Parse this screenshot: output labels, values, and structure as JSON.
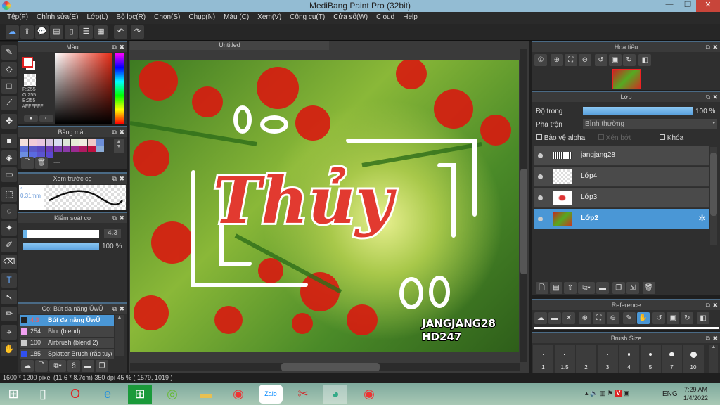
{
  "window": {
    "title": "MediBang Paint Pro (32bit)",
    "min": "—",
    "max": "❐",
    "close": "✕"
  },
  "menu": [
    "Tệp(F)",
    "Chỉnh sửa(E)",
    "Lớp(L)",
    "Bộ lọc(R)",
    "Chọn(S)",
    "Chụp(N)",
    "Màu (C)",
    "Xem(V)",
    "Công cụ(T)",
    "Cửa sổ(W)",
    "Cloud",
    "Help"
  ],
  "canvas": {
    "tab": "Untitled",
    "art_text": "Thủy",
    "watermark1": "JANGJANG28",
    "watermark2": "HD247"
  },
  "color_panel": {
    "title": "Màu",
    "r": "R:255",
    "g": "G:255",
    "b": "B:255",
    "hex": "#FFFFFF",
    "primary": "#ffffff",
    "accent": "#e02020"
  },
  "palette_panel": {
    "title": "Bảng màu",
    "colors": [
      "#f3e0dc",
      "#f2ccd8",
      "#e8c6e0",
      "#d6c6e0",
      "#d8dcf0",
      "#dce6d8",
      "#e6ecd6",
      "#f0ece0",
      "#f0c8c8",
      "#6c8ed8",
      "#5a6ed8",
      "#5a58c8",
      "#5a48c0",
      "#6a3cb8",
      "#7c3cb0",
      "#8a3aa8",
      "#9a2a90",
      "#b01a60",
      "#c01040",
      "#8cacd8",
      "#6c8ee0",
      "#5a6ae0",
      "#5a54d0",
      "#5a48d0"
    ],
    "dash": "---"
  },
  "brush_preview": {
    "title": "Xem trước cọ",
    "size": "0.31mm"
  },
  "brush_control": {
    "title": "Kiểm soát cọ",
    "size": "4.3",
    "opacity": "100 %",
    "size_fraction": 0.05,
    "opacity_fraction": 1.0
  },
  "brush_list": {
    "title": "Cọ: Bút đa năng ŬwŬ",
    "items": [
      {
        "size": "4.3",
        "name": "Bút đa năng ŬwŬ",
        "color": "#222222"
      },
      {
        "size": "254",
        "name": "Blur (blend)",
        "color": "#f0a0f0"
      },
      {
        "size": "100",
        "name": "Airbrush (blend 2)",
        "color": "#cccccc"
      },
      {
        "size": "185",
        "name": "Splatter Brush (rắc tuyết)",
        "color": "#3050f0"
      }
    ]
  },
  "navigator": {
    "title": "Hoa tiêu"
  },
  "layers": {
    "title": "Lớp",
    "opacity_label": "Độ trong",
    "opacity_value": "100 %",
    "opacity_fraction": 1.0,
    "blend_label": "Pha trộn",
    "blend_value": "Bình thường",
    "protect_alpha": "Bảo vệ alpha",
    "clip": "Xén bớt",
    "lock": "Khóa",
    "items": [
      {
        "name": "jangjang28"
      },
      {
        "name": "Lớp4"
      },
      {
        "name": "Lớp3"
      },
      {
        "name": "Lớp2"
      }
    ]
  },
  "reference": {
    "title": "Reference"
  },
  "brush_size": {
    "title": "Brush Size",
    "sizes": [
      "1",
      "1.5",
      "2",
      "3",
      "4",
      "5",
      "7",
      "10"
    ]
  },
  "status": "1600 * 1200 pixel   (11.6 * 8.7cm)   350 dpi   45 %   ( 1579, 1019 )",
  "taskbar": {
    "lang": "ENG",
    "time": "7:29 AM",
    "date": "1/4/2022",
    "zalo": "Zalo"
  }
}
